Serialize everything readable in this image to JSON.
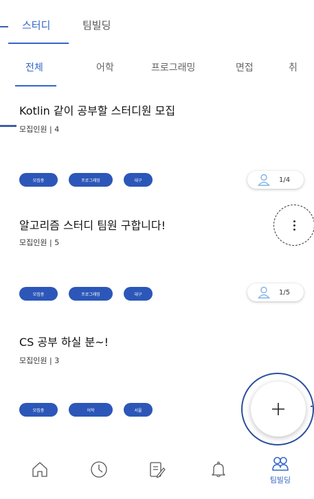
{
  "top_tabs": [
    {
      "label": "스터디",
      "active": true
    },
    {
      "label": "팀빌딩",
      "active": false
    }
  ],
  "categories": [
    {
      "label": "전체",
      "active": true
    },
    {
      "label": "어학",
      "active": false
    },
    {
      "label": "프로그래밍",
      "active": false
    },
    {
      "label": "면접",
      "active": false
    },
    {
      "label": "취",
      "active": false
    }
  ],
  "posts": [
    {
      "title": "Kotlin 같이 공부할 스터디원 모집",
      "recruit_label": "모집인원 | ",
      "recruit_count": "4",
      "tags": [
        "모집중",
        "프로그래밍",
        "대구"
      ],
      "people": "1/4"
    },
    {
      "title": "알고리즘 스터디 팀원 구합니다!",
      "recruit_label": "모집인원 | ",
      "recruit_count": "5",
      "tags": [
        "모집중",
        "프로그래밍",
        "대구"
      ],
      "people": "1/5"
    },
    {
      "title": "CS 공부 하실 분~!",
      "recruit_label": "모집인원 | ",
      "recruit_count": "3",
      "tags": [
        "모집중",
        "어학",
        "서울"
      ],
      "people": ""
    }
  ],
  "nav": {
    "active_label": "팀빌딩",
    "icons": [
      "home-icon",
      "clock-icon",
      "edit-icon",
      "bell-icon",
      "team-icon"
    ]
  },
  "colors": {
    "accent": "#3566c9",
    "tag_bg": "#2c57b8"
  }
}
